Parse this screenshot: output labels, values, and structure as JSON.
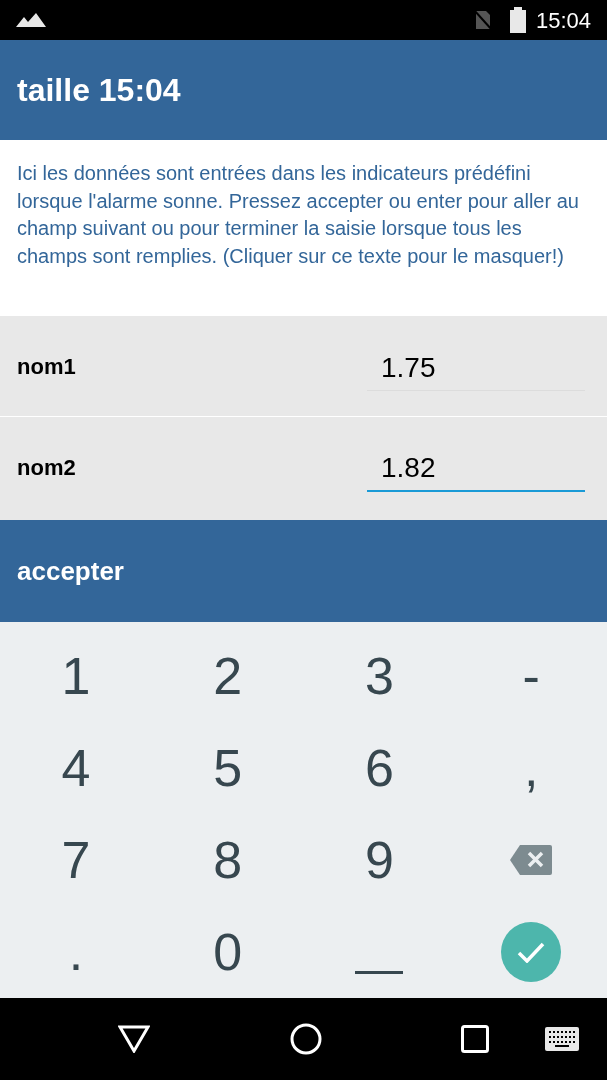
{
  "status_bar": {
    "time": "15:04"
  },
  "app_bar": {
    "title": "taille 15:04"
  },
  "info_text": "Ici les données sont entrées dans les indicateurs prédéfini lorsque l'alarme sonne. Pressez accepter ou enter pour aller au champ suivant ou pour terminer la saisie lorsque tous les champs sont remplies. (Cliquer sur ce texte pour le masquer!)",
  "fields": [
    {
      "label": "nom1",
      "value": "1.75",
      "focused": false
    },
    {
      "label": "nom2",
      "value": "1.82",
      "focused": true
    }
  ],
  "accept_button": "accepter",
  "keypad": [
    {
      "kind": "char",
      "label": "1"
    },
    {
      "kind": "char",
      "label": "2"
    },
    {
      "kind": "char",
      "label": "3"
    },
    {
      "kind": "char",
      "label": "-"
    },
    {
      "kind": "char",
      "label": "4"
    },
    {
      "kind": "char",
      "label": "5"
    },
    {
      "kind": "char",
      "label": "6"
    },
    {
      "kind": "char",
      "label": ","
    },
    {
      "kind": "char",
      "label": "7"
    },
    {
      "kind": "char",
      "label": "8"
    },
    {
      "kind": "char",
      "label": "9"
    },
    {
      "kind": "backspace"
    },
    {
      "kind": "char",
      "label": "."
    },
    {
      "kind": "char",
      "label": "0"
    },
    {
      "kind": "space"
    },
    {
      "kind": "done"
    }
  ]
}
